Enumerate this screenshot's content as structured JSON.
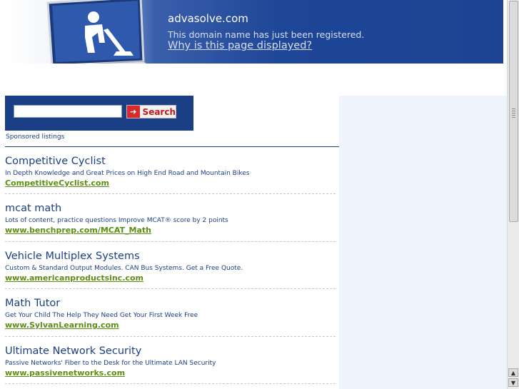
{
  "header": {
    "domain": "advasolve.com",
    "registered_text": "This domain name has just been registered.",
    "why_link": "Why is this page displayed?",
    "laptop_icon": "laptop-construction-icon"
  },
  "search": {
    "input_value": "",
    "button_label": "Search",
    "arrow_icon": "arrow-right-icon"
  },
  "sponsored_label": "Sponsored listings",
  "listings": [
    {
      "title": "Competitive Cyclist",
      "description": "In Depth Knowledge and Great Prices on High End Road and Mountain Bikes",
      "url": "CompetitiveCyclist.com"
    },
    {
      "title": "mcat math",
      "description": "Lots of content, practice questions Improve MCAT® score by 2 points",
      "url": "www.benchprep.com/MCAT_Math"
    },
    {
      "title": "Vehicle Multiplex Systems",
      "description": "Custom & Standard Output Modules. CAN Bus Systems. Get a Free Quote.",
      "url": "www.americanproductsinc.com"
    },
    {
      "title": "Math Tutor",
      "description": "Get Your Child The Help They Need Get Your First Week Free",
      "url": "www.SylvanLearning.com"
    },
    {
      "title": "Ultimate Network Security",
      "description": "Passive Networks' Fiber to the Desk for the Ultimate LAN Security",
      "url": "www.passivenetworks.com"
    }
  ],
  "colors": {
    "banner_blue": "#1f4797",
    "listing_title": "#1b3f85",
    "listing_url": "#5c8e14",
    "search_red": "#d72a2a",
    "right_panel": "#edf4fc"
  }
}
